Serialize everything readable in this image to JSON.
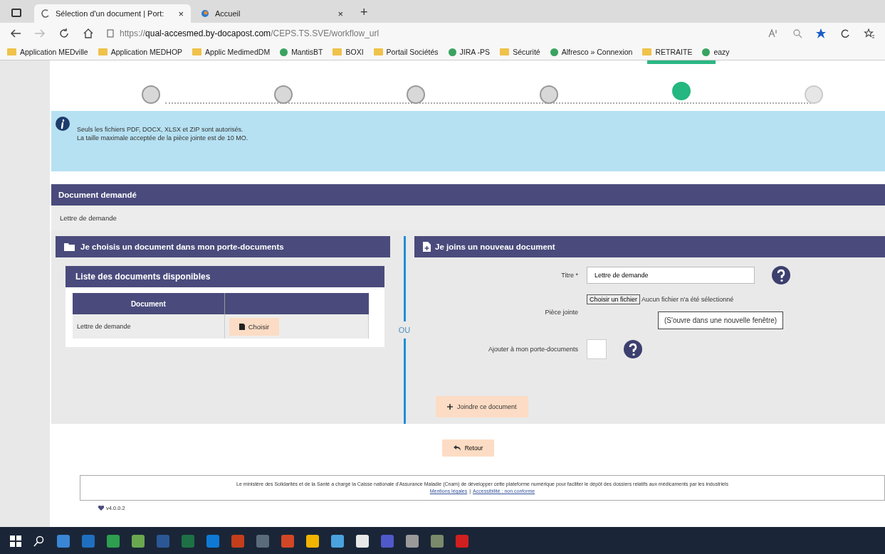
{
  "browser": {
    "tabs": [
      {
        "title": "Sélection d'un document | Port:",
        "selected": true,
        "close": "×"
      },
      {
        "title": "Accueil",
        "selected": false,
        "close": "×"
      }
    ],
    "new_tab": "+",
    "address": {
      "scheme": "https://",
      "host": "qual-accesmed.by-docapost.com",
      "path": "/CEPS.TS.SVE/workflow_url"
    },
    "bookmarks": [
      {
        "label": "Application MEDville",
        "kind": "folder"
      },
      {
        "label": "Application MEDHOP",
        "kind": "folder"
      },
      {
        "label": "Applic MedimedDM",
        "kind": "folder"
      },
      {
        "label": "MantisBT",
        "kind": "site"
      },
      {
        "label": "BOXI",
        "kind": "folder"
      },
      {
        "label": "Portail Sociétés",
        "kind": "folder"
      },
      {
        "label": "JIRA -PS",
        "kind": "site"
      },
      {
        "label": "Sécurité",
        "kind": "folder"
      },
      {
        "label": "Alfresco » Connexion",
        "kind": "site"
      },
      {
        "label": "RETRAITE",
        "kind": "folder"
      },
      {
        "label": "eazy",
        "kind": "site"
      }
    ]
  },
  "stepper": {
    "steps": [
      {
        "completed": true,
        "active": false
      },
      {
        "completed": true,
        "active": false
      },
      {
        "completed": true,
        "active": false
      },
      {
        "completed": true,
        "active": false
      },
      {
        "completed": false,
        "active": true
      },
      {
        "completed": false,
        "active": false
      }
    ]
  },
  "info": {
    "lines": [
      "Seuls les fichiers PDF, DOCX, XLSX et ZIP sont autorisés.",
      "La taille maximale acceptée de la pièce jointe est de 10 MO."
    ]
  },
  "requested": {
    "title": "Document demandé",
    "value": "Lettre de demande"
  },
  "left": {
    "title": "Je choisis un document dans mon porte-documents",
    "list_title": "Liste des documents disponibles",
    "columns": [
      "Document"
    ],
    "rows": [
      {
        "name": "Lettre de demande",
        "action": "Choisir"
      }
    ]
  },
  "separator": "OU",
  "right": {
    "title": "Je joins un nouveau document",
    "title_label": "Titre *",
    "title_value": "Lettre de demande",
    "file_label": "Pièce jointe",
    "file_button": "Choisir un fichier",
    "file_status": "Aucun fichier n'a été sélectionné",
    "tooltip": "(S'ouvre dans une nouvelle fenêtre)",
    "add_label": "Ajouter à mon porte-documents",
    "add_checked": false,
    "submit": "Joindre ce document"
  },
  "back": "Retour",
  "footer": {
    "text": "Le ministère des Solidarités et de la Santé a chargé la Caisse nationale d'Assurance Maladie (Cnam) de développer cette plateforme numérique pour faciliter le dépôt des dossiers relatifs aux médicaments par les industriels",
    "links": [
      "Mentions légales",
      "Accessibilité : non conforme"
    ],
    "link_sep": "|"
  },
  "version": "v4.0.0.2"
}
